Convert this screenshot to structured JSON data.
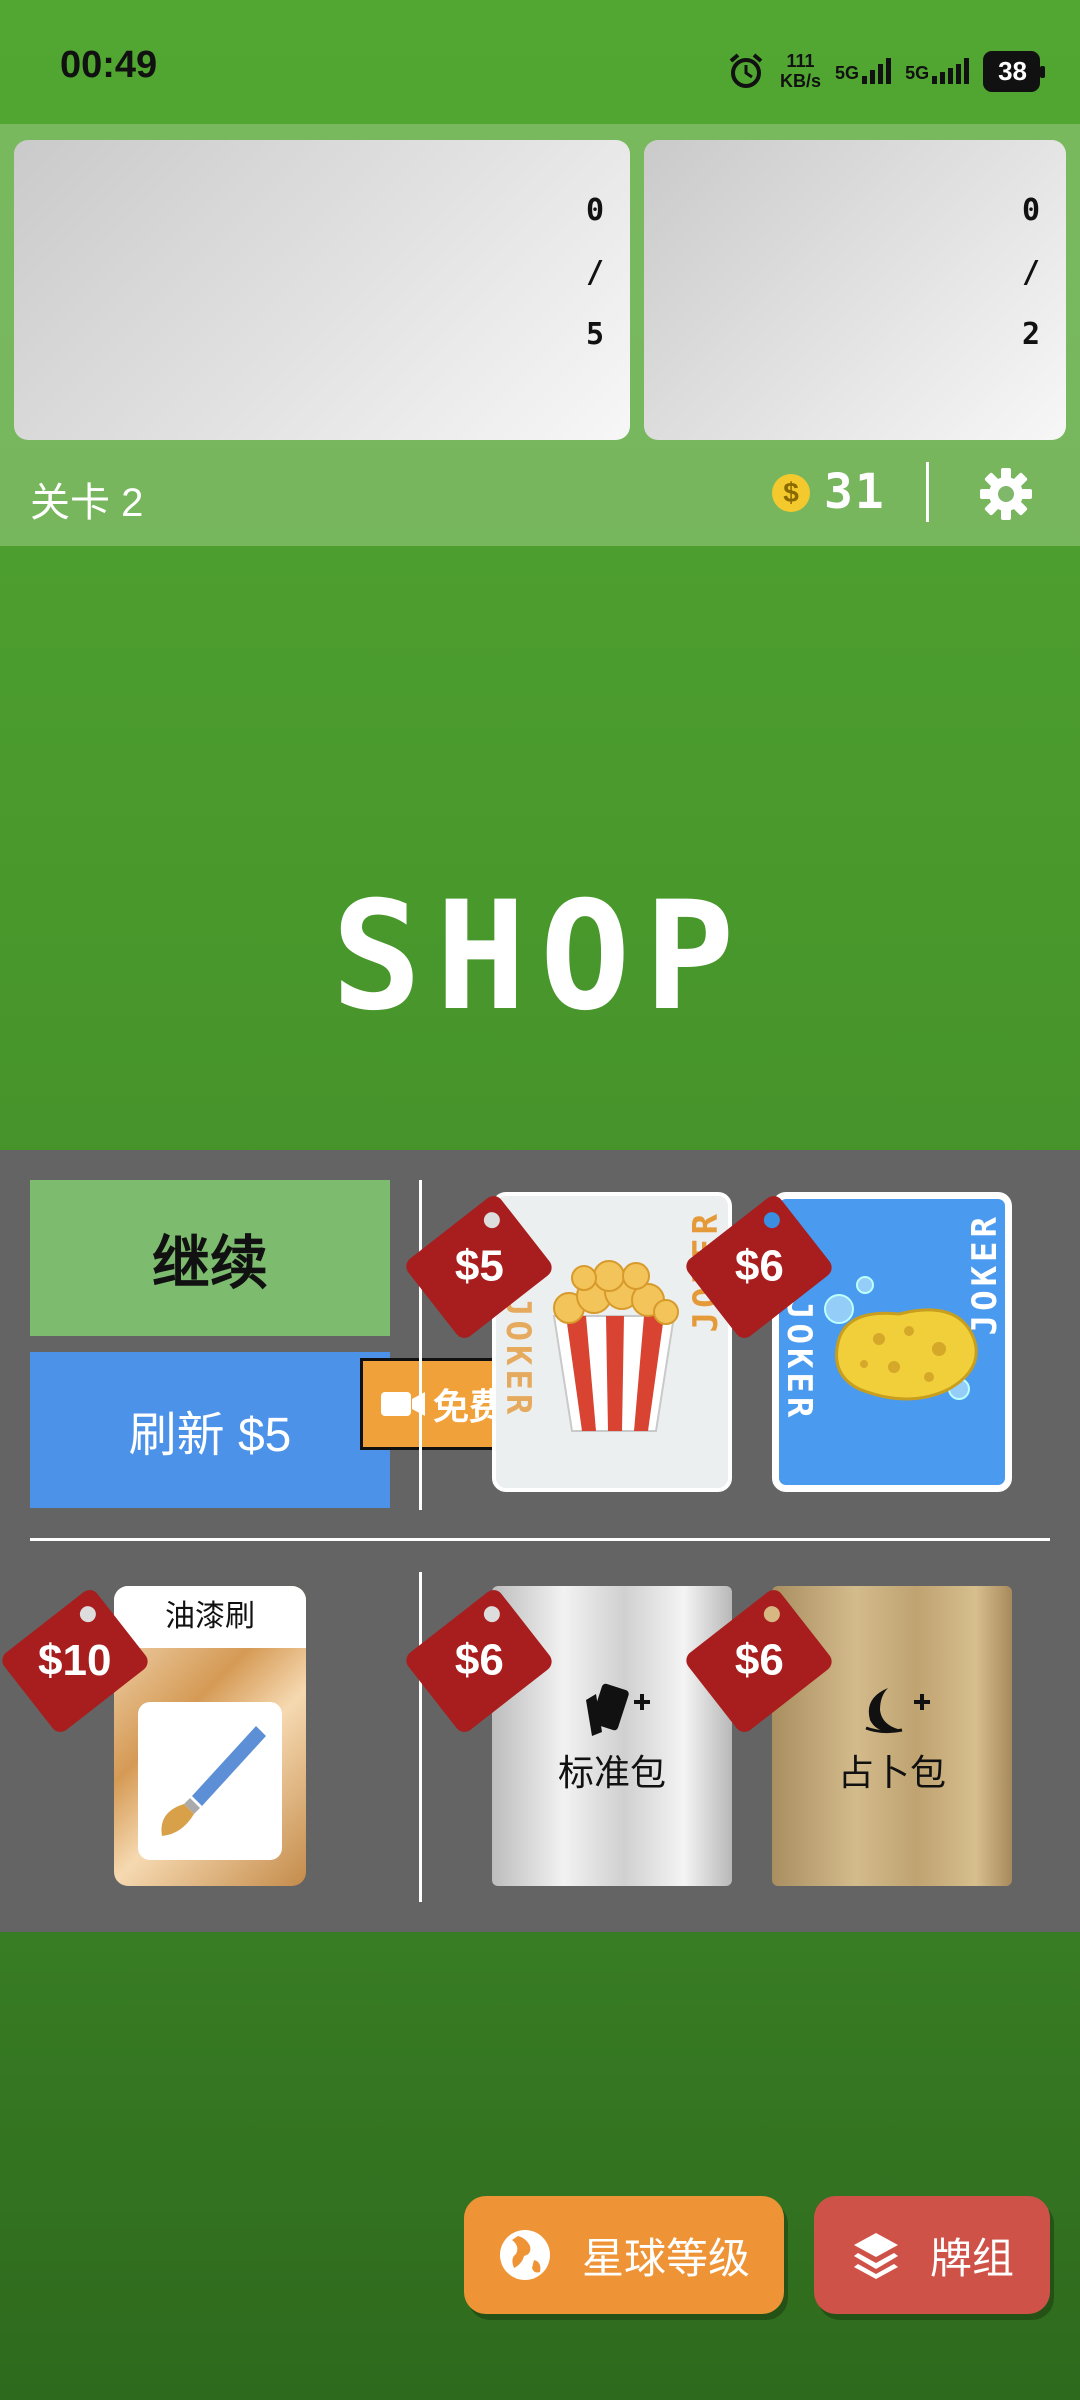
{
  "status_bar": {
    "time": "00:49",
    "speed_value": "111",
    "speed_unit": "KB/s",
    "network_1": "5G",
    "network_2": "5G",
    "battery": "38"
  },
  "score_panel": {
    "left_card": {
      "top": "0",
      "slash": "/",
      "bottom": "5"
    },
    "right_card": {
      "top": "0",
      "slash": "/",
      "bottom": "2"
    }
  },
  "header": {
    "level_label": "关卡 2",
    "coin_symbol": "$",
    "coins": "31"
  },
  "shop_title": "SHOP",
  "shop": {
    "continue_label": "继续",
    "refresh_label": "刷新 $5",
    "free_label": "免费",
    "cards": [
      {
        "name": "popcorn",
        "price": "$5",
        "side_text": "JOKER"
      },
      {
        "name": "sponge",
        "price": "$6",
        "side_text": "JOKER"
      }
    ],
    "voucher": {
      "label": "油漆刷",
      "price": "$10"
    },
    "packs": [
      {
        "label": "标准包",
        "price": "$6"
      },
      {
        "label": "占卜包",
        "price": "$6"
      }
    ]
  },
  "bottom_buttons": {
    "planet_label": "星球等级",
    "deck_label": "牌组"
  },
  "colors": {
    "background": "#4a9a2e",
    "shop_panel": "#646464",
    "continue": "#7dbb6f",
    "refresh": "#4b92e8",
    "free": "#f0a13a",
    "price_tag": "#a81d1d",
    "planet_button": "#ee9437",
    "deck_button": "#cf5249"
  }
}
